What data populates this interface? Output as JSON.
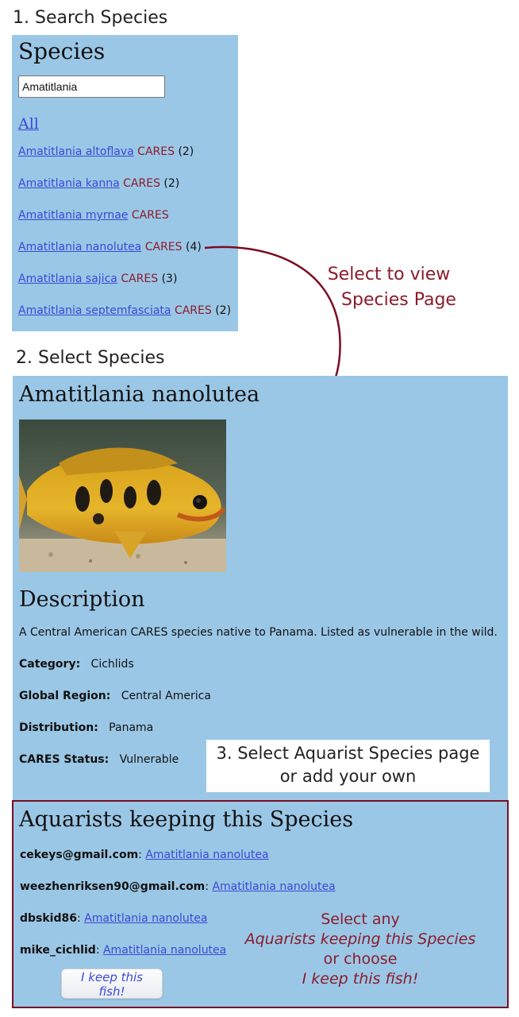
{
  "step1": "1. Search Species",
  "step2": "2. Select Species",
  "step3": {
    "line1": "3. Select Aquarist Species page",
    "line2": "or add your own"
  },
  "search_panel": {
    "title": "Species",
    "search_value": "Amatitlania",
    "all_link": "All",
    "items": [
      {
        "name": "Amatitlania altoflava",
        "badge": "CARES",
        "count": "(2)"
      },
      {
        "name": "Amatitlania kanna",
        "badge": "CARES",
        "count": "(2)"
      },
      {
        "name": "Amatitlania myrnae",
        "badge": "CARES",
        "count": ""
      },
      {
        "name": "Amatitlania nanolutea",
        "badge": "CARES",
        "count": "(4)"
      },
      {
        "name": "Amatitlania sajica",
        "badge": "CARES",
        "count": "(3)"
      },
      {
        "name": "Amatitlania septemfasciata",
        "badge": "CARES",
        "count": "(2)"
      }
    ]
  },
  "callout_select": {
    "line1": "Select to view",
    "line2": "Species Page"
  },
  "species_page": {
    "title": "Amatitlania nanolutea",
    "image_alt": "Amatitlania nanolutea fish photo",
    "description_heading": "Description",
    "description": "A Central American CARES species native to Panama. Listed as vulnerable in the wild.",
    "fields": [
      {
        "label": "Category:",
        "value": "Cichlids"
      },
      {
        "label": "Global Region:",
        "value": "Central America"
      },
      {
        "label": "Distribution:",
        "value": "Panama"
      },
      {
        "label": "CARES Status:",
        "value": "Vulnerable"
      }
    ]
  },
  "aquarists": {
    "heading": "Aquarists keeping this Species",
    "items": [
      {
        "user": "cekeys@gmail.com",
        "link": "Amatitlania nanolutea"
      },
      {
        "user": "weezhenriksen90@gmail.com",
        "link": "Amatitlania nanolutea"
      },
      {
        "user": "dbskid86",
        "link": "Amatitlania nanolutea"
      },
      {
        "user": "mike_cichlid",
        "link": "Amatitlania nanolutea"
      }
    ],
    "keep_button": "I keep this fish!"
  },
  "callout_aquarists": {
    "line1": "Select any",
    "line2": "Aquarists keeping this Species",
    "line3": "or choose",
    "line4": "I keep this fish!"
  },
  "colors": {
    "panel": "#9bc7e6",
    "link": "#3c48d6",
    "cares": "#8a1c2b",
    "annotation": "#8a1c2b",
    "frame": "#7a0d22"
  }
}
